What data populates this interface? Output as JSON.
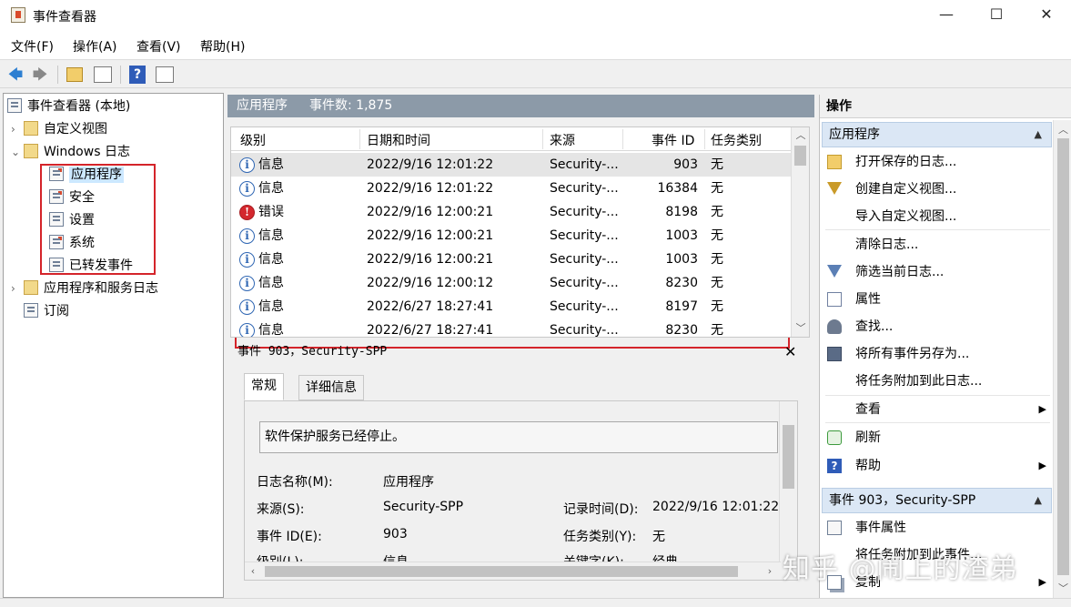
{
  "window": {
    "title": "事件查看器",
    "minimize": "—",
    "maximize": "☐",
    "close": "✕"
  },
  "menu": [
    "文件(F)",
    "操作(A)",
    "查看(V)",
    "帮助(H)"
  ],
  "toolbar": {
    "back": "🡄",
    "forward": "🡆",
    "help": "?"
  },
  "tree": {
    "root": "事件查看器 (本地)",
    "custom_views": "自定义视图",
    "windows_logs": "Windows 日志",
    "logs": [
      "应用程序",
      "安全",
      "设置",
      "系统",
      "已转发事件"
    ],
    "app_service_logs": "应用程序和服务日志",
    "subscriptions": "订阅"
  },
  "center": {
    "title": "应用程序",
    "count_label": "事件数: 1,875"
  },
  "list": {
    "columns": [
      "级别",
      "日期和时间",
      "来源",
      "事件 ID",
      "任务类别"
    ],
    "rows": [
      {
        "level": "信息",
        "type": "info",
        "datetime": "2022/9/16 12:01:22",
        "source": "Security-...",
        "id": "903",
        "task": "无"
      },
      {
        "level": "信息",
        "type": "info",
        "datetime": "2022/9/16 12:01:22",
        "source": "Security-...",
        "id": "16384",
        "task": "无"
      },
      {
        "level": "错误",
        "type": "err",
        "datetime": "2022/9/16 12:00:21",
        "source": "Security-...",
        "id": "8198",
        "task": "无"
      },
      {
        "level": "信息",
        "type": "info",
        "datetime": "2022/9/16 12:00:21",
        "source": "Security-...",
        "id": "1003",
        "task": "无"
      },
      {
        "level": "信息",
        "type": "info",
        "datetime": "2022/9/16 12:00:21",
        "source": "Security-...",
        "id": "1003",
        "task": "无"
      },
      {
        "level": "信息",
        "type": "info",
        "datetime": "2022/9/16 12:00:12",
        "source": "Security-...",
        "id": "8230",
        "task": "无"
      },
      {
        "level": "信息",
        "type": "info",
        "datetime": "2022/6/27 18:27:41",
        "source": "Security-...",
        "id": "8197",
        "task": "无"
      },
      {
        "level": "信息",
        "type": "info",
        "datetime": "2022/6/27 18:27:41",
        "source": "Security-...",
        "id": "8230",
        "task": "无"
      }
    ]
  },
  "detail": {
    "header": "事件 903，Security-SPP",
    "close": "✕",
    "tabs": [
      "常规",
      "详细信息"
    ],
    "description": "软件保护服务已经停止。",
    "fields": {
      "log_name_label": "日志名称(M):",
      "log_name": "应用程序",
      "source_label": "来源(S):",
      "source": "Security-SPP",
      "logged_label": "记录时间(D):",
      "logged": "2022/9/16 12:01:22",
      "event_id_label": "事件 ID(E):",
      "event_id": "903",
      "task_label": "任务类别(Y):",
      "task": "无",
      "level_label": "级别(L):",
      "level": "信息",
      "keywords_label": "关键字(K):",
      "keywords": "经典"
    }
  },
  "actions": {
    "title": "操作",
    "section1": "应用程序",
    "items1": [
      "打开保存的日志...",
      "创建自定义视图...",
      "导入自定义视图...",
      "清除日志...",
      "筛选当前日志...",
      "属性",
      "查找...",
      "将所有事件另存为...",
      "将任务附加到此日志...",
      "查看",
      "刷新",
      "帮助"
    ],
    "section2": "事件 903，Security-SPP",
    "items2": [
      "事件属性",
      "将任务附加到此事件...",
      "复制"
    ]
  },
  "watermark": "知乎 @闹上的渣弟"
}
